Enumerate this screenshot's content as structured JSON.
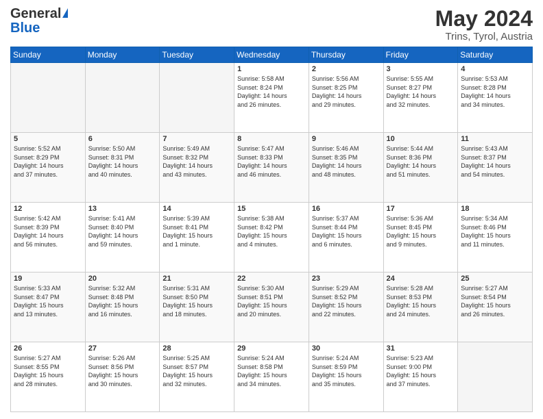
{
  "logo": {
    "general": "General",
    "blue": "Blue"
  },
  "title": "May 2024",
  "subtitle": "Trins, Tyrol, Austria",
  "days": [
    "Sunday",
    "Monday",
    "Tuesday",
    "Wednesday",
    "Thursday",
    "Friday",
    "Saturday"
  ],
  "weeks": [
    [
      {
        "day": "",
        "info": ""
      },
      {
        "day": "",
        "info": ""
      },
      {
        "day": "",
        "info": ""
      },
      {
        "day": "1",
        "info": "Sunrise: 5:58 AM\nSunset: 8:24 PM\nDaylight: 14 hours\nand 26 minutes."
      },
      {
        "day": "2",
        "info": "Sunrise: 5:56 AM\nSunset: 8:25 PM\nDaylight: 14 hours\nand 29 minutes."
      },
      {
        "day": "3",
        "info": "Sunrise: 5:55 AM\nSunset: 8:27 PM\nDaylight: 14 hours\nand 32 minutes."
      },
      {
        "day": "4",
        "info": "Sunrise: 5:53 AM\nSunset: 8:28 PM\nDaylight: 14 hours\nand 34 minutes."
      }
    ],
    [
      {
        "day": "5",
        "info": "Sunrise: 5:52 AM\nSunset: 8:29 PM\nDaylight: 14 hours\nand 37 minutes."
      },
      {
        "day": "6",
        "info": "Sunrise: 5:50 AM\nSunset: 8:31 PM\nDaylight: 14 hours\nand 40 minutes."
      },
      {
        "day": "7",
        "info": "Sunrise: 5:49 AM\nSunset: 8:32 PM\nDaylight: 14 hours\nand 43 minutes."
      },
      {
        "day": "8",
        "info": "Sunrise: 5:47 AM\nSunset: 8:33 PM\nDaylight: 14 hours\nand 46 minutes."
      },
      {
        "day": "9",
        "info": "Sunrise: 5:46 AM\nSunset: 8:35 PM\nDaylight: 14 hours\nand 48 minutes."
      },
      {
        "day": "10",
        "info": "Sunrise: 5:44 AM\nSunset: 8:36 PM\nDaylight: 14 hours\nand 51 minutes."
      },
      {
        "day": "11",
        "info": "Sunrise: 5:43 AM\nSunset: 8:37 PM\nDaylight: 14 hours\nand 54 minutes."
      }
    ],
    [
      {
        "day": "12",
        "info": "Sunrise: 5:42 AM\nSunset: 8:39 PM\nDaylight: 14 hours\nand 56 minutes."
      },
      {
        "day": "13",
        "info": "Sunrise: 5:41 AM\nSunset: 8:40 PM\nDaylight: 14 hours\nand 59 minutes."
      },
      {
        "day": "14",
        "info": "Sunrise: 5:39 AM\nSunset: 8:41 PM\nDaylight: 15 hours\nand 1 minute."
      },
      {
        "day": "15",
        "info": "Sunrise: 5:38 AM\nSunset: 8:42 PM\nDaylight: 15 hours\nand 4 minutes."
      },
      {
        "day": "16",
        "info": "Sunrise: 5:37 AM\nSunset: 8:44 PM\nDaylight: 15 hours\nand 6 minutes."
      },
      {
        "day": "17",
        "info": "Sunrise: 5:36 AM\nSunset: 8:45 PM\nDaylight: 15 hours\nand 9 minutes."
      },
      {
        "day": "18",
        "info": "Sunrise: 5:34 AM\nSunset: 8:46 PM\nDaylight: 15 hours\nand 11 minutes."
      }
    ],
    [
      {
        "day": "19",
        "info": "Sunrise: 5:33 AM\nSunset: 8:47 PM\nDaylight: 15 hours\nand 13 minutes."
      },
      {
        "day": "20",
        "info": "Sunrise: 5:32 AM\nSunset: 8:48 PM\nDaylight: 15 hours\nand 16 minutes."
      },
      {
        "day": "21",
        "info": "Sunrise: 5:31 AM\nSunset: 8:50 PM\nDaylight: 15 hours\nand 18 minutes."
      },
      {
        "day": "22",
        "info": "Sunrise: 5:30 AM\nSunset: 8:51 PM\nDaylight: 15 hours\nand 20 minutes."
      },
      {
        "day": "23",
        "info": "Sunrise: 5:29 AM\nSunset: 8:52 PM\nDaylight: 15 hours\nand 22 minutes."
      },
      {
        "day": "24",
        "info": "Sunrise: 5:28 AM\nSunset: 8:53 PM\nDaylight: 15 hours\nand 24 minutes."
      },
      {
        "day": "25",
        "info": "Sunrise: 5:27 AM\nSunset: 8:54 PM\nDaylight: 15 hours\nand 26 minutes."
      }
    ],
    [
      {
        "day": "26",
        "info": "Sunrise: 5:27 AM\nSunset: 8:55 PM\nDaylight: 15 hours\nand 28 minutes."
      },
      {
        "day": "27",
        "info": "Sunrise: 5:26 AM\nSunset: 8:56 PM\nDaylight: 15 hours\nand 30 minutes."
      },
      {
        "day": "28",
        "info": "Sunrise: 5:25 AM\nSunset: 8:57 PM\nDaylight: 15 hours\nand 32 minutes."
      },
      {
        "day": "29",
        "info": "Sunrise: 5:24 AM\nSunset: 8:58 PM\nDaylight: 15 hours\nand 34 minutes."
      },
      {
        "day": "30",
        "info": "Sunrise: 5:24 AM\nSunset: 8:59 PM\nDaylight: 15 hours\nand 35 minutes."
      },
      {
        "day": "31",
        "info": "Sunrise: 5:23 AM\nSunset: 9:00 PM\nDaylight: 15 hours\nand 37 minutes."
      },
      {
        "day": "",
        "info": ""
      }
    ]
  ]
}
